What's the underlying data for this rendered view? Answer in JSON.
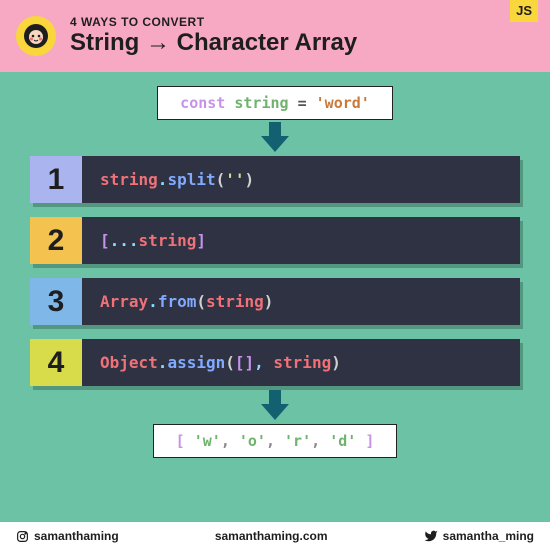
{
  "header": {
    "subtitle": "4 WAYS TO CONVERT",
    "title": "String → Character Array",
    "badge": "JS"
  },
  "input": {
    "kw": "const",
    "var": "string",
    "eq": "=",
    "str": "'word'"
  },
  "methods": [
    {
      "num": "1",
      "numClass": "num1",
      "tokens": [
        [
          "tk-obj",
          "string"
        ],
        [
          "tk-op",
          "."
        ],
        [
          "tk-fn",
          "split"
        ],
        [
          "tk-paren",
          "("
        ],
        [
          "tk-lit",
          "''"
        ],
        [
          "tk-paren",
          ")"
        ]
      ]
    },
    {
      "num": "2",
      "numClass": "num2",
      "tokens": [
        [
          "tk-brack",
          "["
        ],
        [
          "tk-spread",
          "..."
        ],
        [
          "tk-obj",
          "string"
        ],
        [
          "tk-brack",
          "]"
        ]
      ]
    },
    {
      "num": "3",
      "numClass": "num3",
      "tokens": [
        [
          "tk-obj",
          "Array"
        ],
        [
          "tk-op",
          "."
        ],
        [
          "tk-fn",
          "from"
        ],
        [
          "tk-paren",
          "("
        ],
        [
          "tk-obj",
          "string"
        ],
        [
          "tk-paren",
          ")"
        ]
      ]
    },
    {
      "num": "4",
      "numClass": "num4",
      "tokens": [
        [
          "tk-obj",
          "Object"
        ],
        [
          "tk-op",
          "."
        ],
        [
          "tk-fn",
          "assign"
        ],
        [
          "tk-paren",
          "("
        ],
        [
          "tk-brack",
          "[]"
        ],
        [
          "tk-op",
          ", "
        ],
        [
          "tk-obj",
          "string"
        ],
        [
          "tk-paren",
          ")"
        ]
      ]
    }
  ],
  "output": {
    "open": "[",
    "items": [
      "'w'",
      "'o'",
      "'r'",
      "'d'"
    ],
    "close": "]"
  },
  "footer": {
    "instagram": "samanthaming",
    "website": "samanthaming.com",
    "twitter": "samantha_ming"
  }
}
